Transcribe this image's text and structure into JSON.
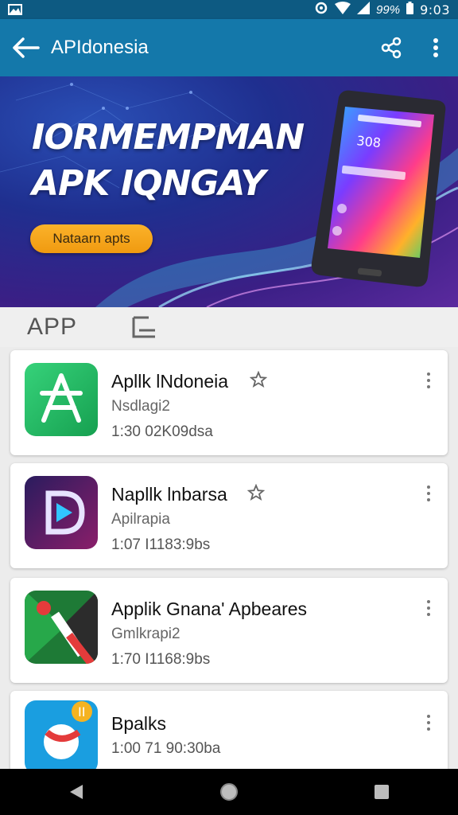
{
  "status_bar": {
    "battery_percent": "99%",
    "time": "9:03"
  },
  "app_bar": {
    "title": "APIdonesia",
    "icons": [
      "back-arrow-icon",
      "share-icon",
      "more-vert-icon"
    ]
  },
  "banner": {
    "headline_line1": "IORMEMPMAN",
    "headline_line2": "APK IQNGAY",
    "cta_label": "Nataarn apts",
    "phone_screen_text": "308"
  },
  "tabs": {
    "app_label": "APP",
    "second_tab_icon": "list-icon"
  },
  "apps": [
    {
      "name": "Apllk lNdoneia",
      "category": "Nsdlagi2",
      "meta": "1:30 02K09dsa",
      "starred": true,
      "icon": "green-a-icon",
      "accent": "#1fb45a"
    },
    {
      "name": "Napllk lnbarsa",
      "category": "Apilrapia",
      "meta": "1:07 I1183:9bs",
      "starred": true,
      "icon": "purple-d-icon",
      "accent": "#5b2a9e"
    },
    {
      "name": "Applik Gnana' Apbeares",
      "category": "Gmlkrapi2",
      "meta": "1:70 I1168:9bs",
      "starred": false,
      "icon": "green-x-icon",
      "accent": "#1e8a3a"
    },
    {
      "name": "Bpalks",
      "category": "",
      "meta": "1:00 71 90:30ba",
      "starred": false,
      "icon": "blue-badge-icon",
      "accent": "#1a9ee0"
    }
  ]
}
